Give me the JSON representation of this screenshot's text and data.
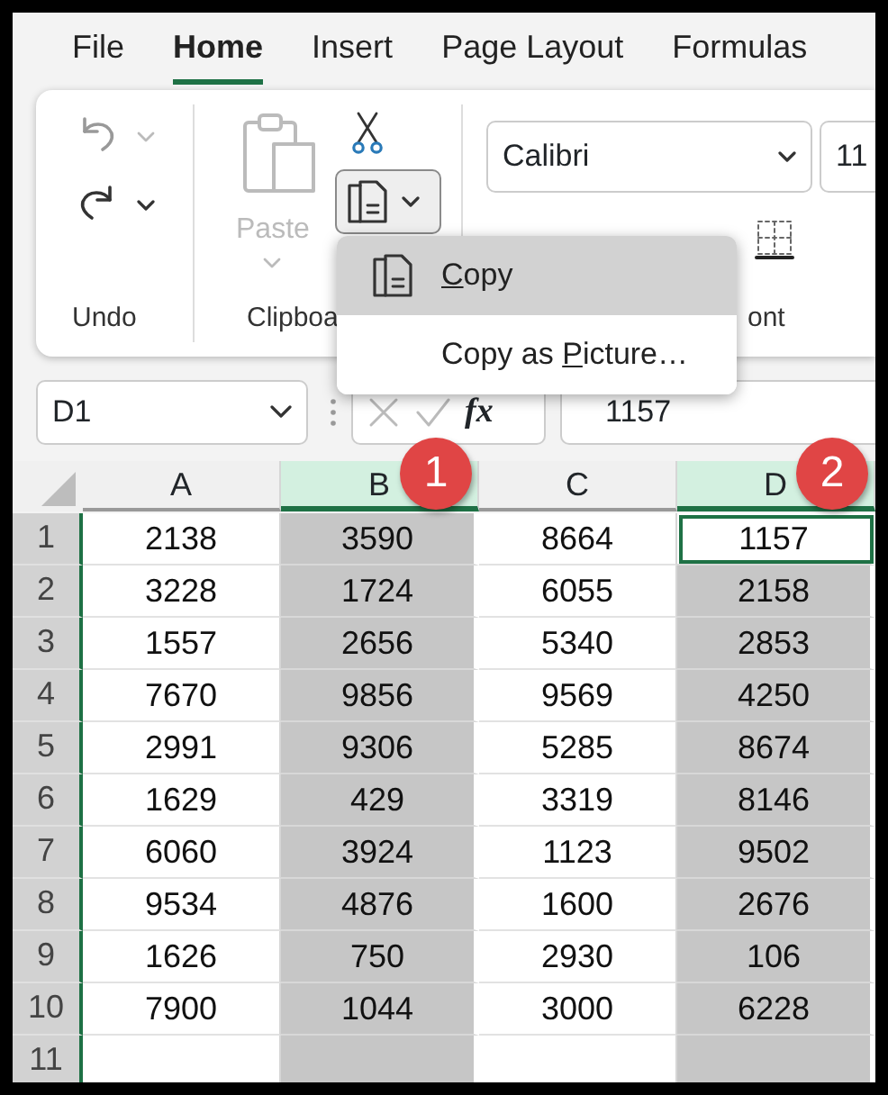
{
  "ribbon_tabs": [
    {
      "label": "File",
      "selected": false
    },
    {
      "label": "Home",
      "selected": true
    },
    {
      "label": "Insert",
      "selected": false
    },
    {
      "label": "Page Layout",
      "selected": false
    },
    {
      "label": "Formulas",
      "selected": false
    }
  ],
  "ribbon": {
    "undo_group": {
      "label": "Undo"
    },
    "clipboard_group": {
      "label": "Clipboa",
      "paste": {
        "label": "Paste",
        "disabled": true
      }
    },
    "font_group": {
      "label": "ont",
      "font_name": "Calibri",
      "font_size": "11"
    }
  },
  "copy_menu": {
    "items": [
      {
        "key": "C",
        "after": "opy",
        "icon": true,
        "selected": true
      },
      {
        "before": "Copy as ",
        "key": "P",
        "after": "icture…",
        "icon": false,
        "selected": false
      }
    ]
  },
  "formula_bar": {
    "name_box": "D1",
    "fx": "fx",
    "value": "1157"
  },
  "sheet": {
    "columns": [
      {
        "label": "A",
        "selected": false,
        "active": false
      },
      {
        "label": "B",
        "selected": true,
        "active": false,
        "callout": "1"
      },
      {
        "label": "C",
        "selected": false,
        "active": false
      },
      {
        "label": "D",
        "selected": true,
        "active": true,
        "callout": "2"
      }
    ],
    "rows": [
      {
        "label": "1",
        "cells": [
          "2138",
          "3590",
          "8664",
          "1157"
        ]
      },
      {
        "label": "2",
        "cells": [
          "3228",
          "1724",
          "6055",
          "2158"
        ]
      },
      {
        "label": "3",
        "cells": [
          "1557",
          "2656",
          "5340",
          "2853"
        ]
      },
      {
        "label": "4",
        "cells": [
          "7670",
          "9856",
          "9569",
          "4250"
        ]
      },
      {
        "label": "5",
        "cells": [
          "2991",
          "9306",
          "5285",
          "8674"
        ]
      },
      {
        "label": "6",
        "cells": [
          "1629",
          "429",
          "3319",
          "8146"
        ]
      },
      {
        "label": "7",
        "cells": [
          "6060",
          "3924",
          "1123",
          "9502"
        ]
      },
      {
        "label": "8",
        "cells": [
          "9534",
          "4876",
          "1600",
          "2676"
        ]
      },
      {
        "label": "9",
        "cells": [
          "1626",
          "750",
          "2930",
          "106"
        ]
      },
      {
        "label": "10",
        "cells": [
          "7900",
          "1044",
          "3000",
          "6228"
        ]
      },
      {
        "label": "11"
      }
    ]
  }
}
